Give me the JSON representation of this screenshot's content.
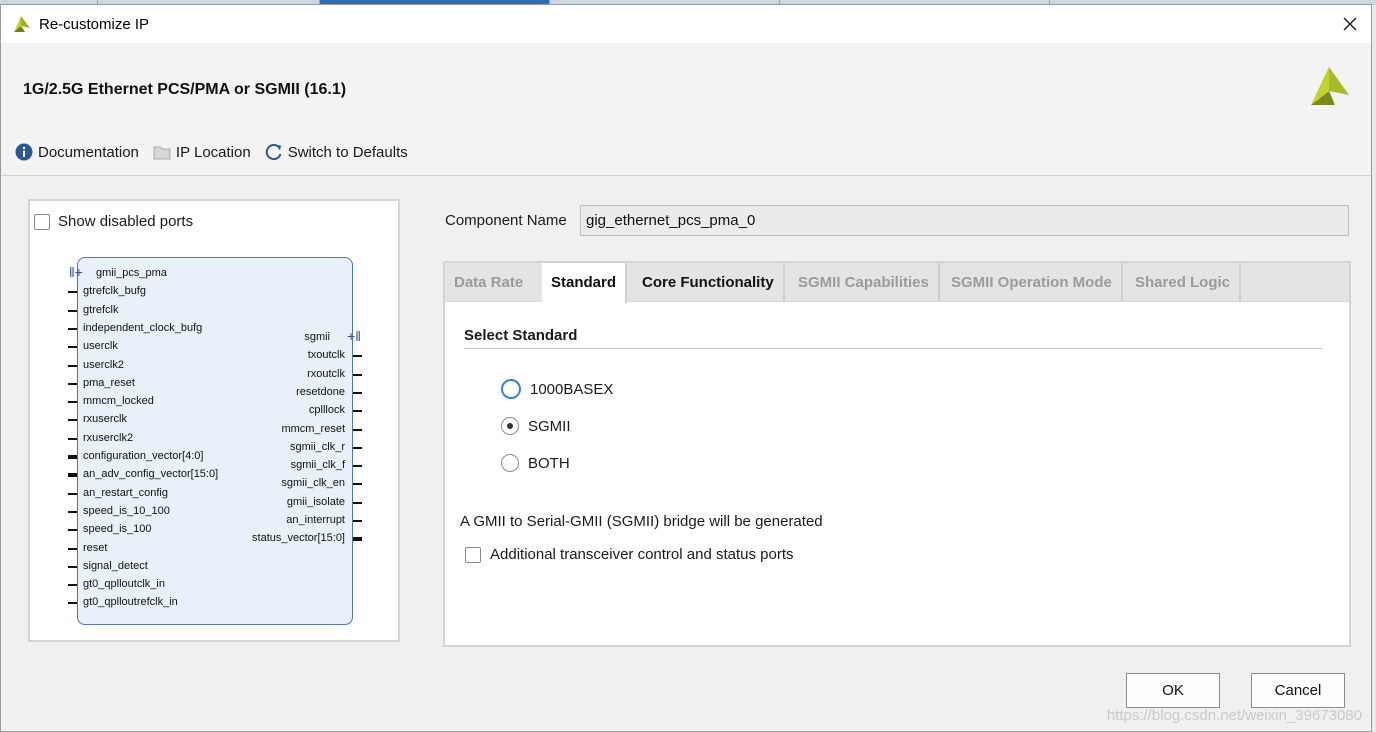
{
  "window": {
    "title": "Re-customize IP",
    "close_icon": "close-icon"
  },
  "header": {
    "ip_title": "1G/2.5G Ethernet PCS/PMA or SGMII (16.1)",
    "toolbar": [
      {
        "label": "Documentation",
        "icon": "info-icon"
      },
      {
        "label": "IP Location",
        "icon": "folder-icon"
      },
      {
        "label": "Switch to Defaults",
        "icon": "refresh-icon"
      }
    ]
  },
  "left_panel": {
    "show_disabled_ports_label": "Show disabled ports",
    "show_disabled_ports_checked": false,
    "symbol": {
      "left_ports": [
        "gmii_pcs_pma",
        "gtrefclk_bufg",
        "gtrefclk",
        "independent_clock_bufg",
        "userclk",
        "userclk2",
        "pma_reset",
        "mmcm_locked",
        "rxuserclk",
        "rxuserclk2",
        "configuration_vector[4:0]",
        "an_adv_config_vector[15:0]",
        "an_restart_config",
        "speed_is_10_100",
        "speed_is_100",
        "reset",
        "signal_detect",
        "gt0_qplloutclk_in",
        "gt0_qplloutrefclk_in"
      ],
      "right_ports": [
        "sgmii",
        "txoutclk",
        "rxoutclk",
        "resetdone",
        "cplllock",
        "mmcm_reset",
        "sgmii_clk_r",
        "sgmii_clk_f",
        "sgmii_clk_en",
        "gmii_isolate",
        "an_interrupt",
        "status_vector[15:0]"
      ]
    }
  },
  "component": {
    "label": "Component Name",
    "value": "gig_ethernet_pcs_pma_0"
  },
  "tabs": [
    {
      "label": "Data Rate"
    },
    {
      "label": "Standard",
      "active": true
    },
    {
      "label": "Core Functionality"
    },
    {
      "label": "SGMII Capabilities"
    },
    {
      "label": "SGMII Operation Mode"
    },
    {
      "label": "Shared Logic"
    }
  ],
  "standard_tab": {
    "section_title": "Select Standard",
    "options": [
      {
        "label": "1000BASEX",
        "selected": false
      },
      {
        "label": "SGMII",
        "selected": true
      },
      {
        "label": "BOTH",
        "selected": false
      }
    ],
    "info_text": "A GMII to Serial-GMII (SGMII) bridge will be generated",
    "extra_ports_label": "Additional transceiver control and status ports",
    "extra_ports_checked": false
  },
  "buttons": {
    "ok": "OK",
    "cancel": "Cancel"
  },
  "watermark": "https://blog.csdn.net/weixin_39673080",
  "colors": {
    "accent": "#3a7fd5",
    "logo_yellow": "#c5d22d",
    "logo_green": "#7b8a1c"
  }
}
